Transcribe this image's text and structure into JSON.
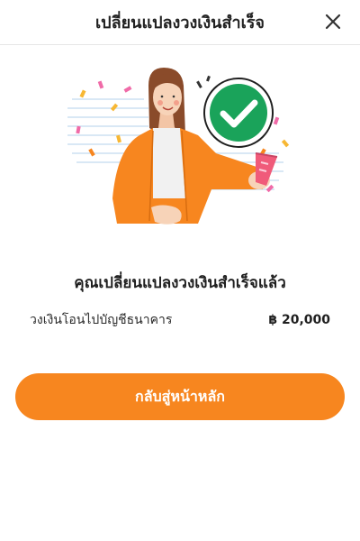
{
  "header": {
    "title": "เปลี่ยนแปลงวงเงินสำเร็จ"
  },
  "content": {
    "success_heading": "คุณเปลี่ยนแปลงวงเงินสำเร็จแล้ว",
    "detail_label": "วงเงินโอนไปบัญชีธนาคาร",
    "detail_value": "฿ 20,000"
  },
  "actions": {
    "back_label": "กลับสู่หน้าหลัก"
  },
  "colors": {
    "accent": "#f7861f",
    "success_green": "#1aa35a"
  },
  "icons": {
    "close": "close-icon",
    "check": "check-icon"
  }
}
